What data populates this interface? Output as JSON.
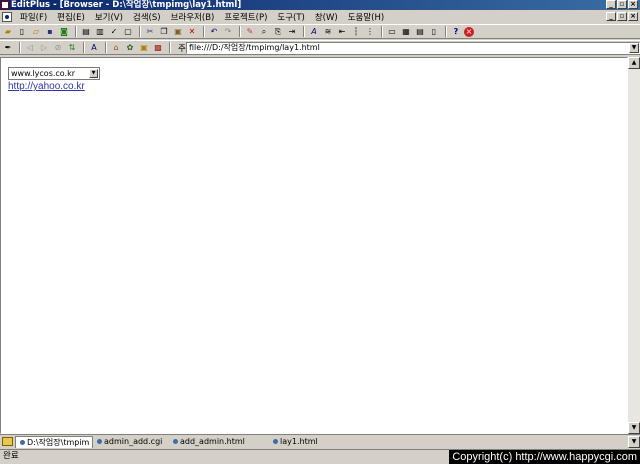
{
  "window": {
    "title": "EditPlus - [Browser - D:\\작업장\\tmpimg\\lay1.html]"
  },
  "menu": [
    {
      "label": "파일(F)"
    },
    {
      "label": "편집(E)"
    },
    {
      "label": "보기(V)"
    },
    {
      "label": "검색(S)"
    },
    {
      "label": "브라우저(B)"
    },
    {
      "label": "프로젝트(P)"
    },
    {
      "label": "도구(T)"
    },
    {
      "label": "창(W)"
    },
    {
      "label": "도움말(H)"
    }
  ],
  "address": {
    "label": "주소(A)",
    "value": "file:///D:/작업장/tmpimg/lay1.html"
  },
  "page": {
    "select_value": "www.lycos.co.kr",
    "link_text": "http://yahoo.co.kr"
  },
  "tabs": [
    {
      "label": "D:\\작업장\\tmpim"
    },
    {
      "label": "admin_add.cgi"
    },
    {
      "label": "add_admin.html"
    },
    {
      "label": "lay1.html"
    }
  ],
  "status": {
    "text": "완료"
  },
  "watermark": "Copyright(c) http://www.happycgi.com"
}
